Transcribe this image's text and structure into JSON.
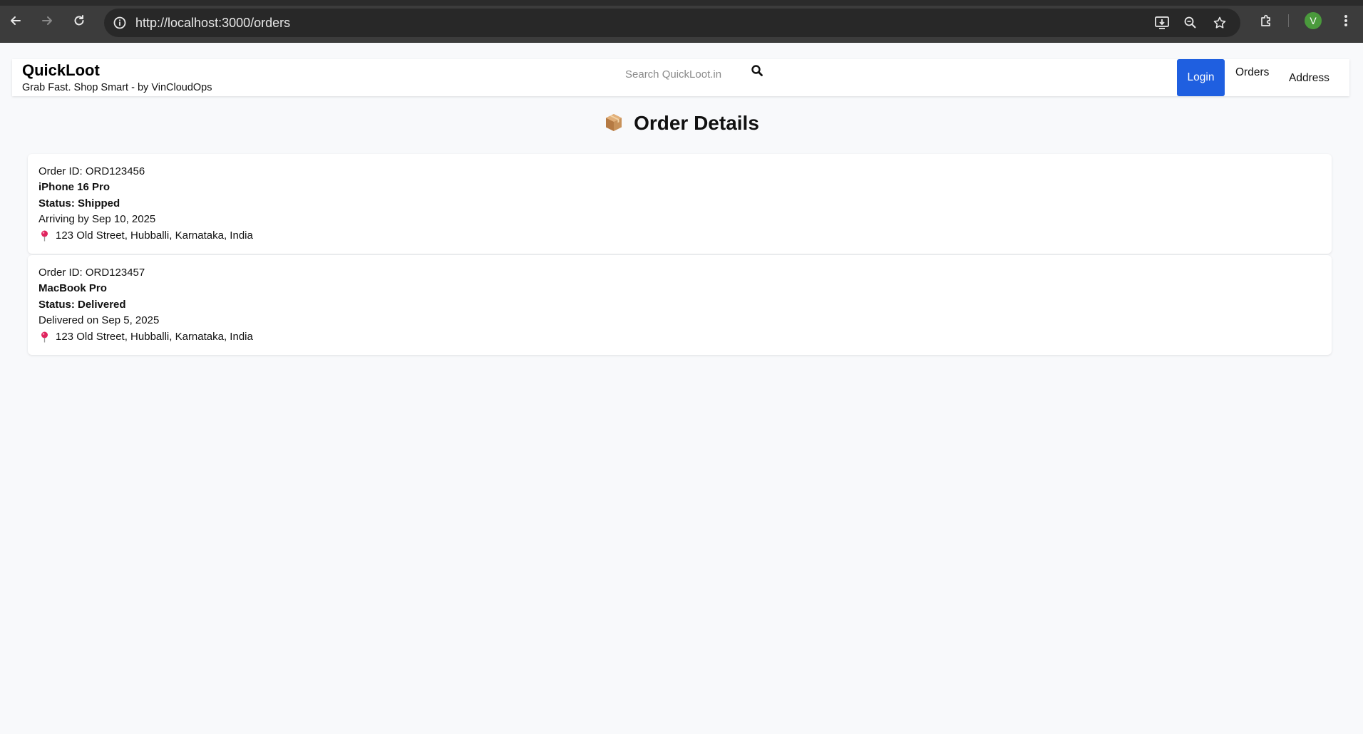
{
  "browser": {
    "url": "http://localhost:3000/orders",
    "profile_initial": "V",
    "icons": [
      "back-icon",
      "forward-icon",
      "reload-icon",
      "info-icon",
      "install-app-icon",
      "zoom-icon",
      "star-icon",
      "extensions-icon",
      "more-icon"
    ]
  },
  "header": {
    "brand": "QuickLoot",
    "tagline": "Grab Fast. Shop Smart - by VinCloudOps",
    "search_placeholder": "Search QuickLoot.in",
    "login_label": "Login",
    "orders_label": "Orders",
    "address_label": "Address",
    "accent_color": "#1f5fe0"
  },
  "page": {
    "title": "Order Details"
  },
  "orders": [
    {
      "order_id": "Order ID: ORD123456",
      "product": "iPhone 16 Pro",
      "status": "Status: Shipped",
      "delivery": "Arriving by Sep 10, 2025",
      "address": "123 Old Street, Hubballi, Karnataka, India"
    },
    {
      "order_id": "Order ID: ORD123457",
      "product": "MacBook Pro",
      "status": "Status: Delivered",
      "delivery": "Delivered on Sep 5, 2025",
      "address": "123 Old Street, Hubballi, Karnataka, India"
    }
  ]
}
